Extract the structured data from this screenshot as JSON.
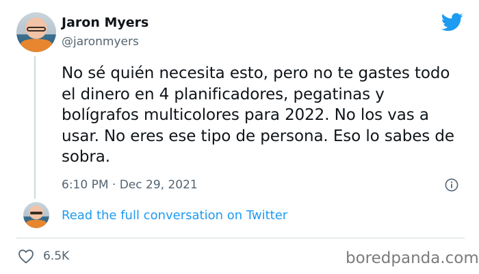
{
  "tweet": {
    "author_name": "Jaron Myers",
    "author_handle": "@jaronmyers",
    "text": "No sé quién necesita esto, pero no te gastes todo el dinero en 4 planificadores, pegatinas y bolígrafos multicolores para 2022. No los vas a usar. No eres ese tipo de persona. Eso lo sabes de sobra.",
    "timestamp": "6:10 PM · Dec 29, 2021",
    "read_more_label": "Read the full conversation on Twitter",
    "likes": "6.5K"
  },
  "watermark": "boredpanda.com",
  "colors": {
    "brand": "#1d9bf0",
    "muted": "#536471",
    "divider": "#cfd9de"
  },
  "icons": [
    "twitter-logo-icon",
    "info-icon",
    "heart-icon"
  ]
}
